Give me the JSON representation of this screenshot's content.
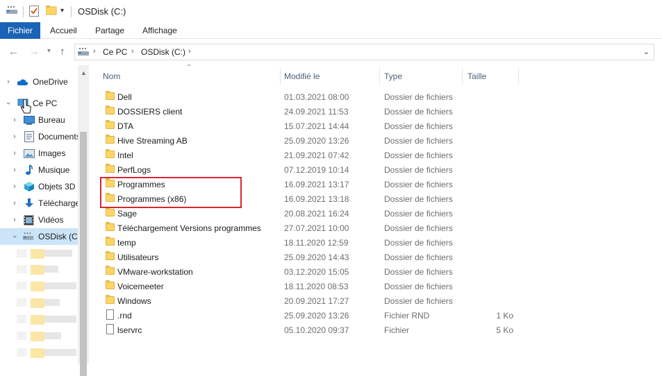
{
  "window": {
    "title": "OSDisk (C:)"
  },
  "ribbon": {
    "tabs": [
      "Fichier",
      "Accueil",
      "Partage",
      "Affichage"
    ]
  },
  "address": {
    "crumbs": [
      "Ce PC",
      "OSDisk (C:)"
    ]
  },
  "tree": {
    "items": [
      {
        "label": "OneDrive",
        "icon": "cloud-icon"
      },
      {
        "label": "Ce PC",
        "icon": "computer-icon"
      },
      {
        "label": "Bureau",
        "icon": "desktop-icon"
      },
      {
        "label": "Documents",
        "icon": "documents-icon"
      },
      {
        "label": "Images",
        "icon": "images-icon"
      },
      {
        "label": "Musique",
        "icon": "music-icon"
      },
      {
        "label": "Objets 3D",
        "icon": "cube-icon"
      },
      {
        "label": "Téléchargements",
        "icon": "download-icon"
      },
      {
        "label": "Vidéos",
        "icon": "video-icon"
      },
      {
        "label": "OSDisk (C:)",
        "icon": "drive-icon"
      }
    ]
  },
  "columns": {
    "name": "Nom",
    "modified": "Modifié le",
    "type": "Type",
    "size": "Taille"
  },
  "files": [
    {
      "name": "Dell",
      "date": "01.03.2021 08:00",
      "type": "Dossier de fichiers",
      "size": "",
      "kind": "folder"
    },
    {
      "name": "DOSSIERS client",
      "date": "24.09.2021 11:53",
      "type": "Dossier de fichiers",
      "size": "",
      "kind": "folder"
    },
    {
      "name": "DTA",
      "date": "15.07.2021 14:44",
      "type": "Dossier de fichiers",
      "size": "",
      "kind": "folder"
    },
    {
      "name": "Hive Streaming AB",
      "date": "25.09.2020 13:26",
      "type": "Dossier de fichiers",
      "size": "",
      "kind": "folder"
    },
    {
      "name": "Intel",
      "date": "21.09.2021 07:42",
      "type": "Dossier de fichiers",
      "size": "",
      "kind": "folder"
    },
    {
      "name": "PerfLogs",
      "date": "07.12.2019 10:14",
      "type": "Dossier de fichiers",
      "size": "",
      "kind": "folder"
    },
    {
      "name": "Programmes",
      "date": "16.09.2021 13:17",
      "type": "Dossier de fichiers",
      "size": "",
      "kind": "folder"
    },
    {
      "name": "Programmes (x86)",
      "date": "16.09.2021 13:18",
      "type": "Dossier de fichiers",
      "size": "",
      "kind": "folder"
    },
    {
      "name": "Sage",
      "date": "20.08.2021 16:24",
      "type": "Dossier de fichiers",
      "size": "",
      "kind": "folder"
    },
    {
      "name": "Téléchargement Versions programmes",
      "date": "27.07.2021 10:00",
      "type": "Dossier de fichiers",
      "size": "",
      "kind": "folder"
    },
    {
      "name": "temp",
      "date": "18.11.2020 12:59",
      "type": "Dossier de fichiers",
      "size": "",
      "kind": "folder"
    },
    {
      "name": "Utilisateurs",
      "date": "25.09.2020 14:43",
      "type": "Dossier de fichiers",
      "size": "",
      "kind": "folder"
    },
    {
      "name": "VMware-workstation",
      "date": "03.12.2020 15:05",
      "type": "Dossier de fichiers",
      "size": "",
      "kind": "folder"
    },
    {
      "name": "Voicemeeter",
      "date": "18.11.2020 08:53",
      "type": "Dossier de fichiers",
      "size": "",
      "kind": "folder"
    },
    {
      "name": "Windows",
      "date": "20.09.2021 17:27",
      "type": "Dossier de fichiers",
      "size": "",
      "kind": "folder"
    },
    {
      "name": ".rnd",
      "date": "25.09.2020 13:26",
      "type": "Fichier RND",
      "size": "1 Ko",
      "kind": "file"
    },
    {
      "name": "lservrc",
      "date": "05.10.2020 09:37",
      "type": "Fichier",
      "size": "5 Ko",
      "kind": "file"
    }
  ],
  "colors": {
    "accent": "#1a63b5",
    "highlight": "#d8262f",
    "selected": "#cce4f7",
    "folder": "#fcd567"
  }
}
